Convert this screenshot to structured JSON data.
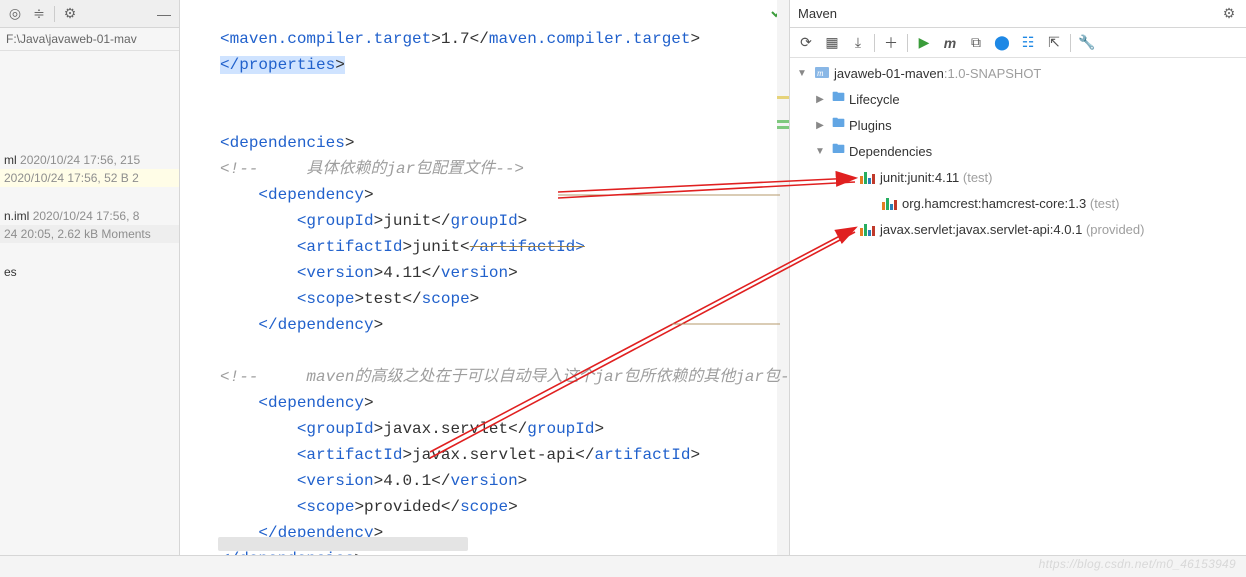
{
  "project": {
    "breadcrumb": "F:\\Java\\javaweb-01-mav",
    "files": [
      {
        "name": "ml",
        "meta": "2020/10/24 17:56, 215",
        "hl": false
      },
      {
        "name": "",
        "meta": "2020/10/24 17:56, 52 B 2",
        "hl": true
      },
      {
        "name": "n.iml",
        "meta": "2020/10/24 17:56, 8",
        "hl": false
      },
      {
        "name": "",
        "meta": "24 20:05, 2.62 kB Moments",
        "hl": true
      },
      {
        "name": "es",
        "meta": "",
        "hl": false
      }
    ]
  },
  "editor": {
    "line1a": "<",
    "line1b": "maven.compiler.target",
    "line1c": ">1.7</",
    "line1d": "maven.compiler.target",
    "line1e": ">",
    "line2a": "</",
    "line2b": "properties",
    "line2c": ">",
    "line3a": "<",
    "line3b": "dependencies",
    "line3c": ">",
    "comment1": "<!--     具体依赖的jar包配置文件-->",
    "dep_open_a": "<",
    "dep_open_b": "dependency",
    "dep_open_c": ">",
    "gid_a": "<",
    "gid_b": "groupId",
    "gid_c": ">junit</",
    "gid_d": "groupId",
    "gid_e": ">",
    "aid_a": "<",
    "aid_b": "artifactId",
    "aid_c": ">junit<",
    "aid_strike": "/artifactId>",
    "ver_a": "<",
    "ver_b": "version",
    "ver_c": ">4.11</",
    "ver_d": "version",
    "ver_e": ">",
    "scp_a": "<",
    "scp_b": "scope",
    "scp_c": ">test</",
    "scp_d": "scope",
    "scp_e": ">",
    "dep_close_a": "</",
    "dep_close_b": "dependency",
    "dep_close_c": ">",
    "comment2": "<!--     maven的高级之处在于可以自动导入这个jar包所依赖的其他jar包-->",
    "gid2_a": "<",
    "gid2_b": "groupId",
    "gid2_c": ">javax.servlet</",
    "gid2_d": "groupId",
    "gid2_e": ">",
    "aid2_a": "<",
    "aid2_b": "artifactId",
    "aid2_c": ">javax.servlet-api</",
    "aid2_d": "artifactId",
    "aid2_e": ">",
    "ver2_a": "<",
    "ver2_b": "version",
    "ver2_c": ">4.0.1</",
    "ver2_d": "version",
    "ver2_e": ">",
    "scp2_a": "<",
    "scp2_b": "scope",
    "scp2_c": ">provided</",
    "scp2_d": "scope",
    "scp2_e": ">",
    "deps_close_a": "</",
    "deps_close_b": "dependencies",
    "deps_close_c": ">"
  },
  "maven": {
    "title": "Maven",
    "root_label": "javaweb-01-maven",
    "root_ver": ":1.0-SNAPSHOT",
    "nodes": {
      "lifecycle": "Lifecycle",
      "plugins": "Plugins",
      "dependencies": "Dependencies"
    },
    "deps": [
      {
        "label": "junit:junit:4.11",
        "scope": "(test)",
        "indent": 1
      },
      {
        "label": "org.hamcrest:hamcrest-core:1.3",
        "scope": "(test)",
        "indent": 2
      },
      {
        "label": "javax.servlet:javax.servlet-api:4.0.1",
        "scope": "(provided)",
        "indent": 1
      }
    ]
  },
  "watermark": "https://blog.csdn.net/m0_46153949"
}
